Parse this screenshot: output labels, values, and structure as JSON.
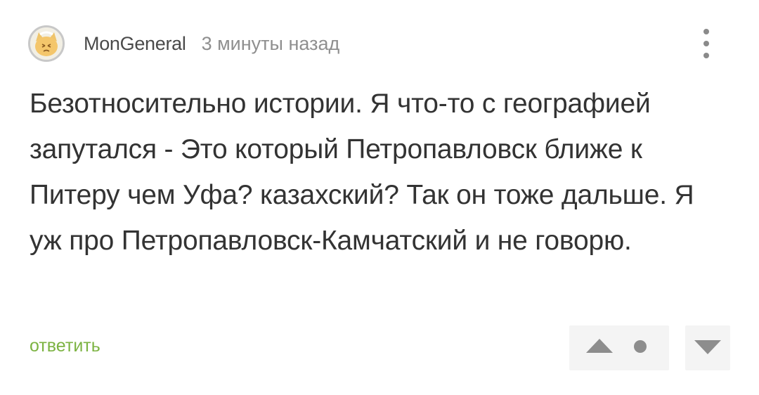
{
  "comment": {
    "author": "MonGeneral",
    "timestamp": "3 минуты назад",
    "avatar_icon": "cat-avatar-icon",
    "text": "Безотносительно истории. Я что-то с географией запутался - Это который Петропавловск ближе к Питеру чем Уфа? казахский? Так он тоже дальше. Я уж про Петропавловск-Камчатский и не говорю.",
    "reply_label": "ответить",
    "more_icon": "vertical-ellipsis-icon",
    "vote_up_icon": "triangle-up-icon",
    "vote_down_icon": "triangle-down-icon",
    "rating_icon": "dot-icon"
  },
  "colors": {
    "text": "#333333",
    "author": "#4a4a4a",
    "timestamp": "#8f8f8f",
    "reply_link": "#7cb342",
    "vote_box_bg": "#f4f4f4",
    "icon_gray": "#8d8d8d"
  }
}
